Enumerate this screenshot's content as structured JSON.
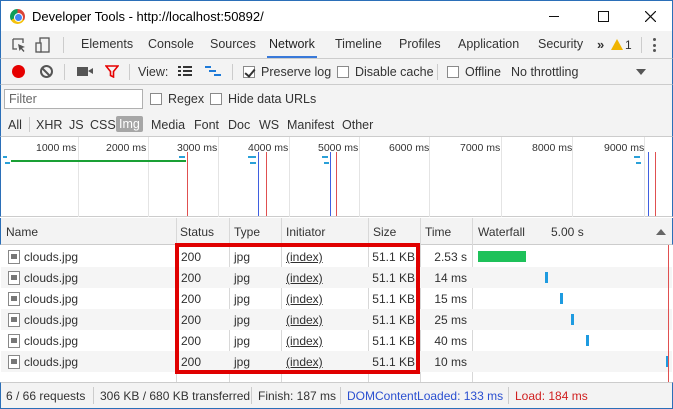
{
  "window": {
    "title": "Developer Tools - http://localhost:50892/"
  },
  "tabs": [
    {
      "label": "Elements"
    },
    {
      "label": "Console"
    },
    {
      "label": "Sources"
    },
    {
      "label": "Network",
      "active": true
    },
    {
      "label": "Timeline"
    },
    {
      "label": "Profiles"
    },
    {
      "label": "Application"
    },
    {
      "label": "Security"
    }
  ],
  "tabs_overflow": "»",
  "warnings": {
    "count": "1",
    "color": "#f0b400"
  },
  "toolbar": {
    "view_label": "View:",
    "preserve_log": {
      "label": "Preserve log",
      "checked": true
    },
    "disable_cache": {
      "label": "Disable cache",
      "checked": false
    },
    "offline": {
      "label": "Offline",
      "checked": false
    },
    "throttling": "No throttling",
    "record_color": "#e60000",
    "filter_color": "#e60000"
  },
  "filterbar": {
    "placeholder": "Filter",
    "regex": {
      "label": "Regex",
      "checked": false
    },
    "hide_data_urls": {
      "label": "Hide data URLs",
      "checked": false
    }
  },
  "types": [
    {
      "label": "All"
    },
    {
      "label": "XHR"
    },
    {
      "label": "JS"
    },
    {
      "label": "CSS"
    },
    {
      "label": "Img",
      "selected": true
    },
    {
      "label": "Media"
    },
    {
      "label": "Font"
    },
    {
      "label": "Doc"
    },
    {
      "label": "WS"
    },
    {
      "label": "Manifest"
    },
    {
      "label": "Other"
    }
  ],
  "overview": {
    "ticks": [
      "1000 ms",
      "2000 ms",
      "3000 ms",
      "4000 ms",
      "5000 ms",
      "6000 ms",
      "7000 ms",
      "8000 ms",
      "9000 ms"
    ]
  },
  "table": {
    "headers": {
      "name": "Name",
      "status": "Status",
      "type": "Type",
      "initiator": "Initiator",
      "size": "Size",
      "time": "Time",
      "waterfall": "Waterfall",
      "waterfall_time": "5.00 s"
    },
    "rows": [
      {
        "name": "clouds.jpg",
        "status": "200",
        "type": "jpg",
        "initiator": "(index)",
        "size": "51.1 KB",
        "time": "2.53 s",
        "bar_start_s": 0.02,
        "bar_duration_s": 2.53,
        "bar_color": "#1ec15a"
      },
      {
        "name": "clouds.jpg",
        "status": "200",
        "type": "jpg",
        "initiator": "(index)",
        "size": "51.1 KB",
        "time": "14 ms",
        "bar_start_s": 3.5,
        "bar_duration_s": 0.014,
        "bar_color": "#1e9be0"
      },
      {
        "name": "clouds.jpg",
        "status": "200",
        "type": "jpg",
        "initiator": "(index)",
        "size": "51.1 KB",
        "time": "15 ms",
        "bar_start_s": 4.3,
        "bar_duration_s": 0.015,
        "bar_color": "#1e9be0"
      },
      {
        "name": "clouds.jpg",
        "status": "200",
        "type": "jpg",
        "initiator": "(index)",
        "size": "51.1 KB",
        "time": "25 ms",
        "bar_start_s": 4.9,
        "bar_duration_s": 0.025,
        "bar_color": "#1e9be0"
      },
      {
        "name": "clouds.jpg",
        "status": "200",
        "type": "jpg",
        "initiator": "(index)",
        "size": "51.1 KB",
        "time": "40 ms",
        "bar_start_s": 5.7,
        "bar_duration_s": 0.04,
        "bar_color": "#1e9be0"
      },
      {
        "name": "clouds.jpg",
        "status": "200",
        "type": "jpg",
        "initiator": "(index)",
        "size": "51.1 KB",
        "time": "10 ms",
        "bar_start_s": 9.9,
        "bar_duration_s": 0.01,
        "bar_color": "#1e9be0"
      }
    ]
  },
  "status": {
    "requests": "6 / 66 requests",
    "transferred": "306 KB / 680 KB transferred",
    "finish": "Finish: 187 ms",
    "dcl": "DOMContentLoaded: 133 ms",
    "load": "Load: 184 ms",
    "dcl_color": "#2a4fd0",
    "load_color": "#d02020"
  },
  "highlight_color": "#e00000"
}
